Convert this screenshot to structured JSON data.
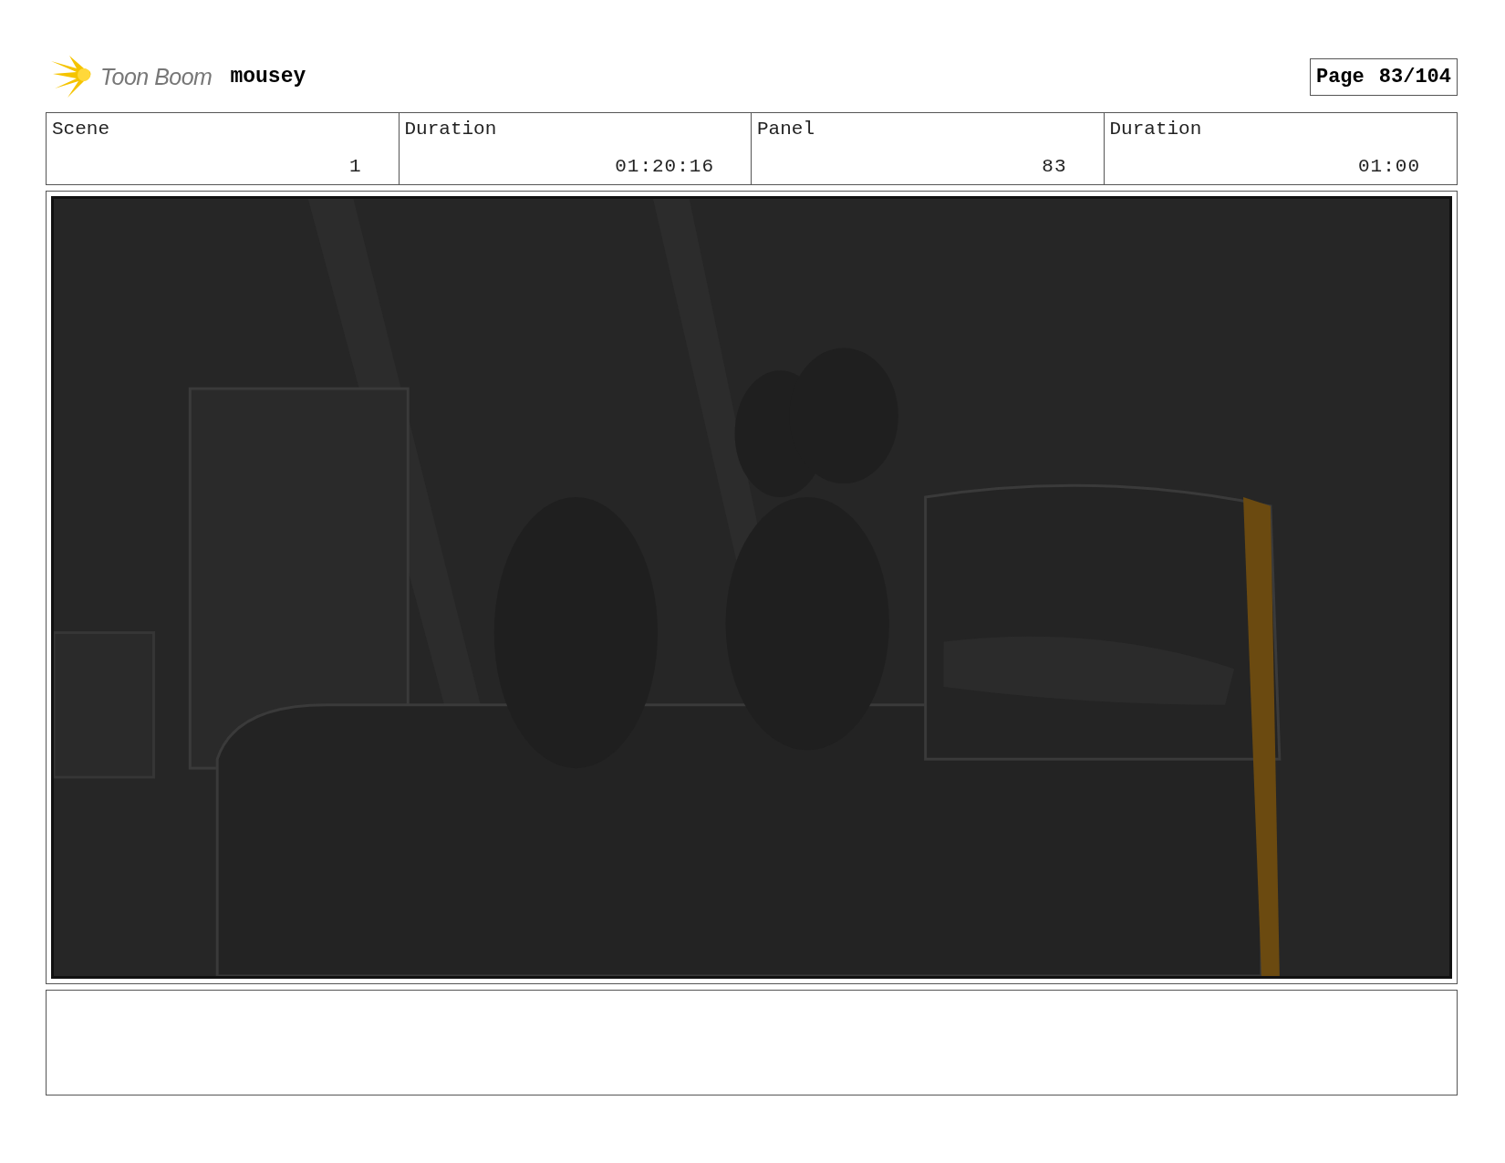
{
  "header": {
    "logo_text": "Toon Boom",
    "project": "mousey",
    "page_label": "Page",
    "page_number": "83/104"
  },
  "info": [
    {
      "label": "Scene",
      "value": "1"
    },
    {
      "label": "Duration",
      "value": "01:20:16"
    },
    {
      "label": "Panel",
      "value": "83"
    },
    {
      "label": "Duration",
      "value": "01:00"
    }
  ]
}
